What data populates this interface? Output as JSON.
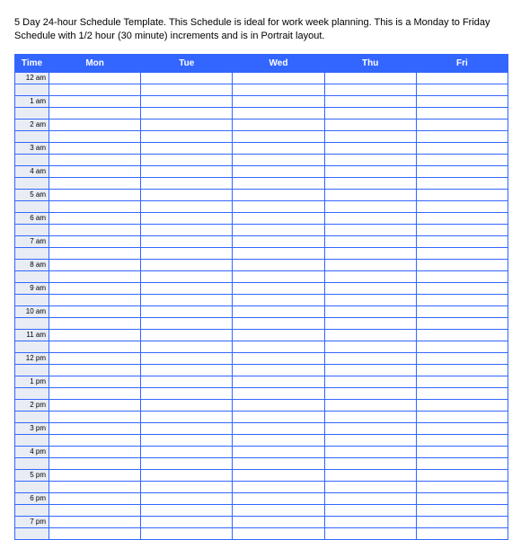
{
  "description": "5 Day 24-hour Schedule Template.  This Schedule is ideal for work week planning.  This is a Monday to Friday Schedule with 1/2 hour (30 minute) increments and is in Portrait layout.",
  "headers": {
    "time": "Time",
    "days": [
      "Mon",
      "Tue",
      "Wed",
      "Thu",
      "Fri"
    ]
  },
  "time_labels": [
    "12 am",
    "1 am",
    "2 am",
    "3 am",
    "4 am",
    "5 am",
    "6 am",
    "7 am",
    "8 am",
    "9 am",
    "10 am",
    "11 am",
    "12 pm",
    "1 pm",
    "2 pm",
    "3 pm",
    "4 pm",
    "5 pm",
    "6 pm",
    "7 pm"
  ]
}
